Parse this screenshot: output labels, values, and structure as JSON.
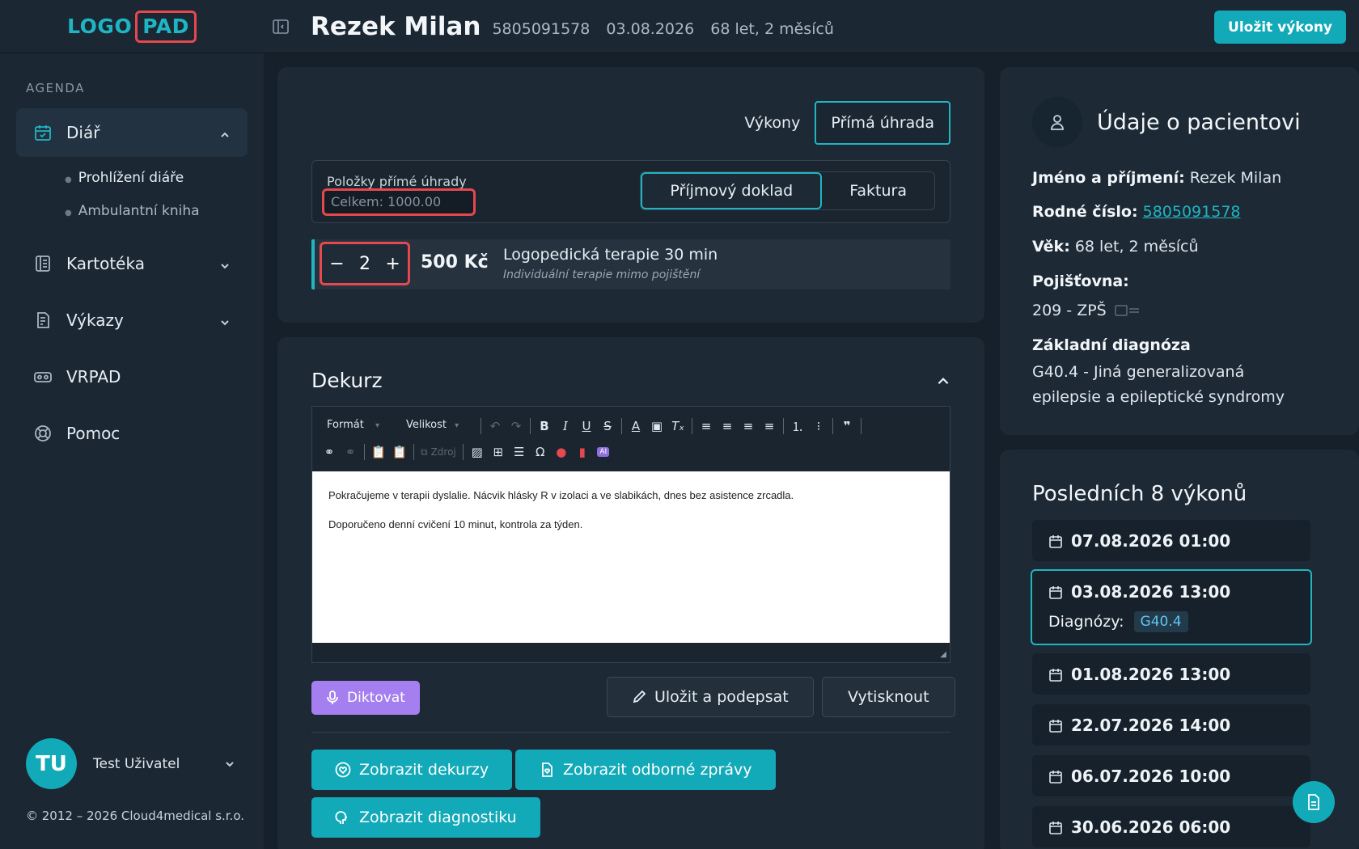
{
  "logo": {
    "part1": "LOGO",
    "part2": "PAD"
  },
  "sidebar": {
    "section_label": "AGENDA",
    "items": [
      {
        "label": "Diář",
        "icon": "calendar-check-icon",
        "active": true
      },
      {
        "label": "Kartotéka",
        "icon": "cards-icon"
      },
      {
        "label": "Výkazy",
        "icon": "report-icon"
      },
      {
        "label": "VRPAD",
        "icon": "vr-headset-icon"
      },
      {
        "label": "Pomoc",
        "icon": "lifebuoy-icon"
      }
    ],
    "subitems": [
      {
        "label": "Prohlížení diáře"
      },
      {
        "label": "Ambulantní kniha"
      }
    ],
    "user": {
      "initials": "TU",
      "name": "Test Uživatel"
    },
    "copyright": "© 2012 – 2026 Cloud4medical s.r.o."
  },
  "header": {
    "patient_name": "Rezek Milan",
    "birth_number": "5805091578",
    "date": "03.08.2026",
    "age": "68 let, 2 měsíců",
    "save_label": "Uložit výkony"
  },
  "payment": {
    "tabs": [
      "Výkony",
      "Přímá úhrada"
    ],
    "active_tab": "Přímá úhrada",
    "items_title": "Položky přímé úhrady",
    "total": "Celkem: 1000.00",
    "doc_tabs": [
      "Příjmový doklad",
      "Faktura"
    ],
    "item": {
      "quantity": "2",
      "price": "500 Kč",
      "name": "Logopedická terapie 30 min",
      "subtitle": "Individuální terapie mimo pojištění"
    }
  },
  "dekurz": {
    "title": "Dekurz",
    "toolbar": {
      "format": "Formát",
      "size": "Velikost",
      "source": "Zdroj"
    },
    "text": [
      "Pokračujeme v terapii dyslalie. Nácvik hlásky R v izolaci a ve slabikách, dnes bez asistence zrcadla.",
      "Doporučeno denní cvičení 10 minut, kontrola za týden."
    ],
    "dictate_label": "Diktovat",
    "sign_label": "Uložit a podepsat",
    "print_label": "Vytisknout",
    "show_dekurzy": "Zobrazit dekurzy",
    "show_reports": "Zobrazit odborné zprávy",
    "show_diagnostics": "Zobrazit diagnostiku"
  },
  "patient_info": {
    "title": "Údaje o pacientovi",
    "name_label": "Jméno a příjmení:",
    "name": "Rezek Milan",
    "rc_label": "Rodné číslo:",
    "rc": "5805091578",
    "age_label": "Věk:",
    "age": "68 let, 2 měsíců",
    "insurance_label": "Pojišťovna:",
    "insurance": "209 - ZPŠ",
    "diag_label": "Základní diagnóza",
    "diag_line1": "G40.4 - Jiná generalizovaná",
    "diag_line2": "epilepsie a epileptické syndromy"
  },
  "last_services": {
    "title": "Posledních 8 výkonů",
    "items": [
      {
        "date": "07.08.2026 01:00"
      },
      {
        "date": "03.08.2026 13:00",
        "diag_label": "Diagnózy:",
        "diag": "G40.4"
      },
      {
        "date": "01.08.2026 13:00"
      },
      {
        "date": "22.07.2026 14:00"
      },
      {
        "date": "06.07.2026 10:00"
      },
      {
        "date": "30.06.2026 06:00"
      }
    ]
  }
}
